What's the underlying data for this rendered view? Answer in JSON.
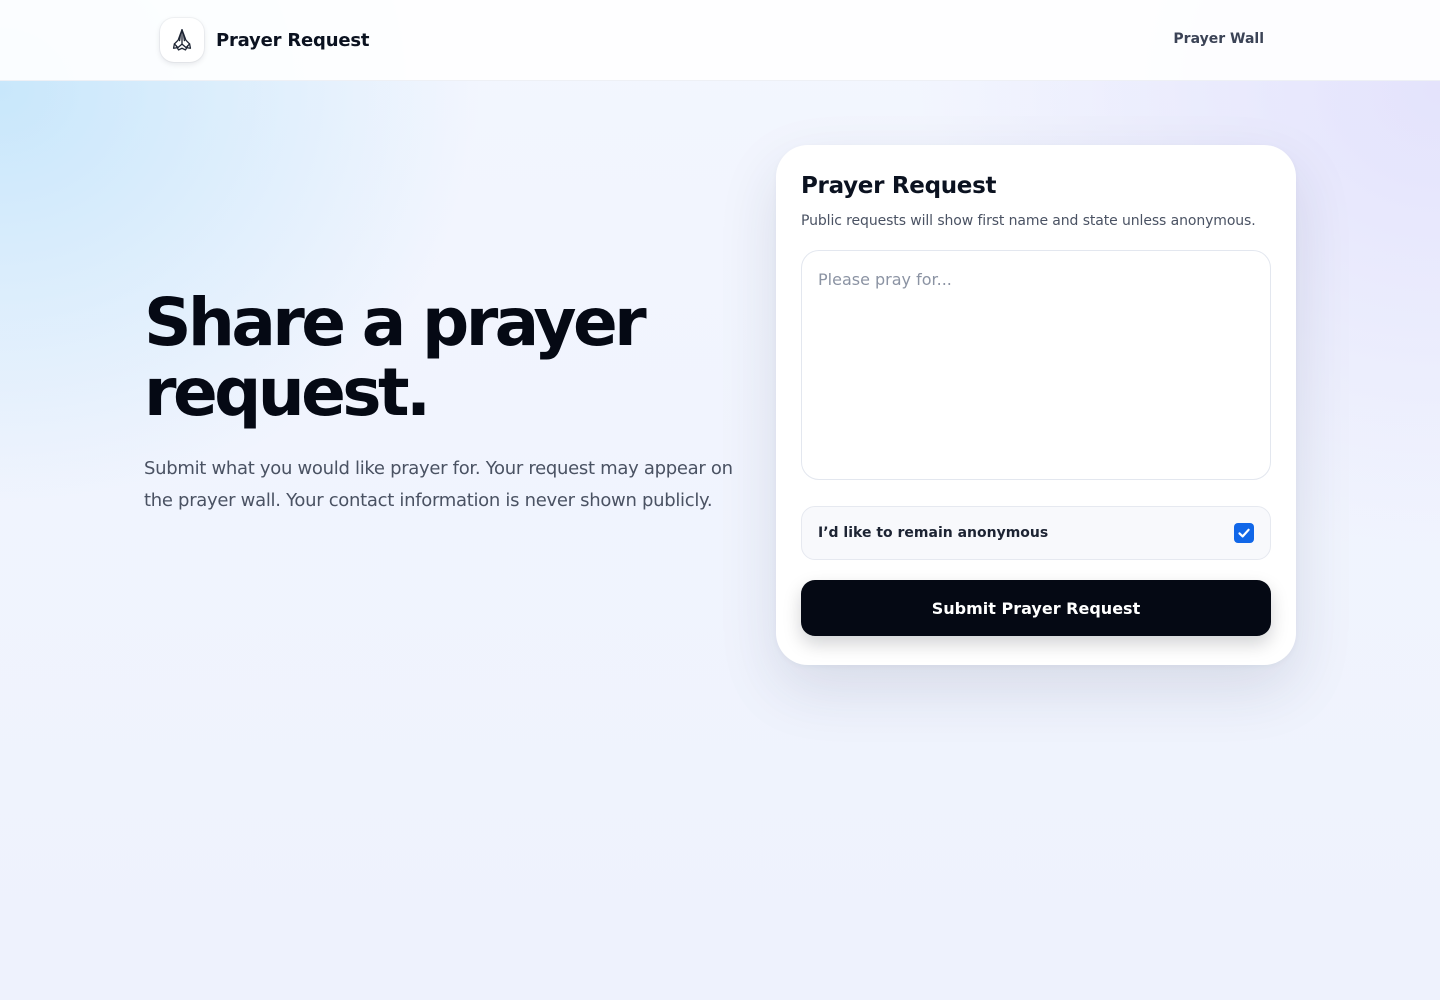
{
  "header": {
    "brand_name": "Prayer Request",
    "logo_icon": "praying-hands-icon",
    "nav_link": "Prayer Wall"
  },
  "hero": {
    "title_line1": "Share a prayer",
    "title_line2": "request.",
    "subtitle": "Submit what you would like prayer for. Your request may appear on the prayer wall. Your contact information is never shown publicly."
  },
  "form": {
    "title": "Prayer Request",
    "subtitle": "Public requests will show first name and state unless anonymous.",
    "textarea_placeholder": "Please pray for...",
    "textarea_value": "",
    "anonymous_label": "I’d like to remain anonymous",
    "anonymous_checked": true,
    "submit_label": "Submit Prayer Request"
  },
  "colors": {
    "accent": "#1167e8",
    "primary_button": "#050914",
    "text_dark": "#0b1220",
    "text_muted": "#4a5263"
  }
}
